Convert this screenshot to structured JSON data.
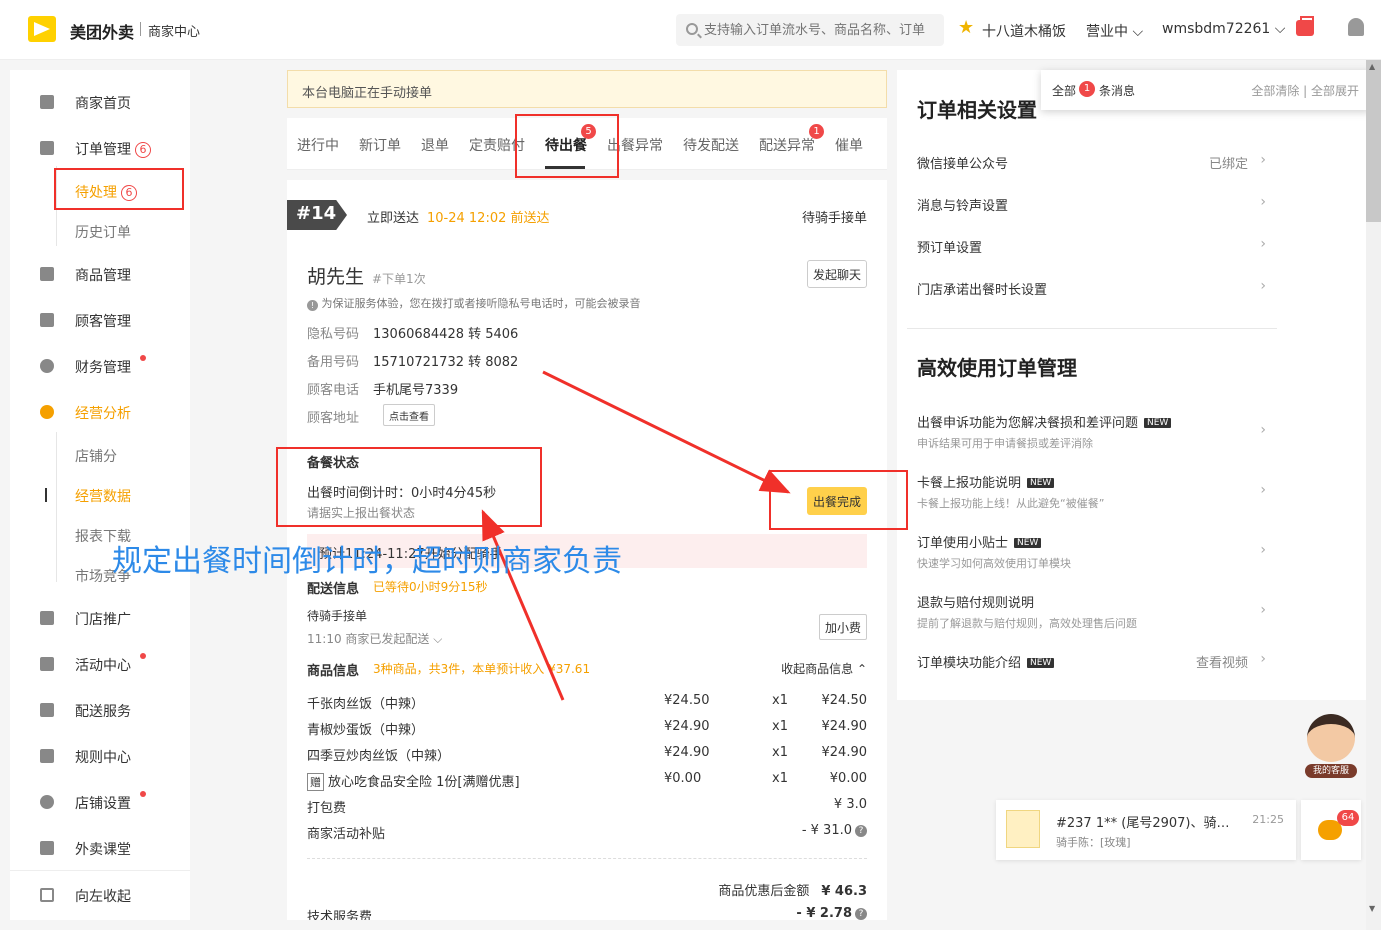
{
  "header": {
    "brand": "美团外卖",
    "brand_sub": "商家中心",
    "search_placeholder": "支持输入订单流水号、商品名称、订单",
    "shop_name": "十八道木桶饭",
    "status": "营业中 ⌵",
    "account": "wmsbdm72261 ⌵"
  },
  "sidebar": {
    "items": [
      {
        "label": "商家首页"
      },
      {
        "label": "订单管理",
        "badge": "6"
      },
      {
        "label": "商品管理"
      },
      {
        "label": "顾客管理"
      },
      {
        "label": "财务管理"
      },
      {
        "label": "经营分析"
      },
      {
        "label": "门店推广"
      },
      {
        "label": "活动中心"
      },
      {
        "label": "配送服务"
      },
      {
        "label": "规则中心"
      },
      {
        "label": "店铺设置"
      },
      {
        "label": "外卖课堂"
      },
      {
        "label": "向左收起"
      }
    ],
    "order_sub": {
      "pending": "待处理",
      "pending_badge": "6",
      "history": "历史订单"
    },
    "analysis_sub": [
      "店铺分",
      "经营数据",
      "报表下载",
      "市场竞争"
    ]
  },
  "notice": "本台电脑正在手动接单",
  "tabs": {
    "items": [
      "进行中",
      "新订单",
      "退单",
      "定责赔付",
      "待出餐",
      "出餐异常",
      "待发配送",
      "配送异常",
      "催单"
    ],
    "active": "待出餐",
    "badge_pending_meal": "5",
    "badge_delivery_exception": "1"
  },
  "order": {
    "number": "#14",
    "delivery_type": "立即送达",
    "delivery_time": "10-24 12:02 前送达",
    "rider_status": "待骑手接单",
    "customer_name": "胡先生",
    "customer_times": "#下单1次",
    "chat_button": "发起聊天",
    "privacy_tip": "为保证服务体验，您在拨打或者接听隐私号电话时，可能会被录音",
    "privacy_number_label": "隐私号码",
    "privacy_number": "13060684428 转 5406",
    "backup_number_label": "备用号码",
    "backup_number": "15710721732 转 8082",
    "customer_phone_label": "顾客电话",
    "customer_phone": "手机尾号7339",
    "address_label": "顾客地址",
    "view_button": "点击查看",
    "prep_title": "备餐状态",
    "prep_countdown": "出餐时间倒计时：0小时4分45秒",
    "prep_hint": "请据实上报出餐状态",
    "done_button": "出餐完成",
    "pink_text": "预计11:24-11:27开始分配骑手",
    "delivery_title": "配送信息",
    "delivery_wait": "已等待0小时9分15秒",
    "delivery_status": "待骑手接单",
    "delivery_note": "11:10 商家已发起配送 ⌵",
    "add_fee_button": "加小费",
    "goods_title": "商品信息",
    "goods_summary": "3种商品，共3件，本单预计收入 ¥37.61",
    "collapse_link": "收起商品信息 ⌃",
    "goods": [
      {
        "name": "千张肉丝饭（中辣）",
        "price": "¥24.50",
        "qty": "x1",
        "total": "¥24.50"
      },
      {
        "name": "青椒炒蛋饭（中辣）",
        "price": "¥24.90",
        "qty": "x1",
        "total": "¥24.90"
      },
      {
        "name": "四季豆炒肉丝饭（中辣）",
        "price": "¥24.90",
        "qty": "x1",
        "total": "¥24.90"
      },
      {
        "name": "放心吃食品安全险 1份[满赠优惠]",
        "price": "¥0.00",
        "qty": "x1",
        "total": "¥0.00",
        "gift": "赠"
      }
    ],
    "packing_fee_label": "打包费",
    "packing_fee": "¥ 3.0",
    "subsidy_label": "商家活动补贴",
    "subsidy": "- ¥ 31.0",
    "discounted_label": "商品优惠后金额",
    "discounted": "¥ 46.3",
    "service_fee_label": "技术服务费",
    "service_fee": "- ¥ 2.78"
  },
  "right_panel": {
    "settings_title": "订单相关设置",
    "settings": [
      {
        "label": "微信接单公众号",
        "value": "已绑定"
      },
      {
        "label": "消息与铃声设置"
      },
      {
        "label": "预订单设置"
      },
      {
        "label": "门店承诺出餐时长设置"
      }
    ],
    "tips_title": "高效使用订单管理",
    "tips": [
      {
        "title": "出餐申诉功能为您解决餐损和差评问题",
        "sub": "申诉结果可用于申请餐损或差评消除",
        "new": "NEW"
      },
      {
        "title": "卡餐上报功能说明",
        "sub": "卡餐上报功能上线！从此避免“被催餐”",
        "new": "NEW"
      },
      {
        "title": "订单使用小贴士",
        "sub": "快速学习如何高效使用订单模块",
        "new": "NEW"
      },
      {
        "title": "退款与赔付规则说明",
        "sub": "提前了解退款与赔付规则，高效处理售后问题"
      },
      {
        "title": "订单模块功能介绍",
        "new": "NEW",
        "value": "查看视频"
      }
    ]
  },
  "messages": {
    "all": "全部",
    "count": "1",
    "text": "条消息",
    "actions": "全部清除 | 全部展开"
  },
  "service_label": "我的客服",
  "notification": {
    "title": "#237  1** (尾号2907)、骑手…",
    "time": "21:25",
    "sub": "骑手陈：[玫瑰]",
    "chat_badge": "64"
  },
  "annotation": "规定出餐时间倒计时，超时则商家负责",
  "colors": {
    "accent": "#f5a000",
    "alert": "#f04848",
    "button_yellow": "#ffd04b",
    "annotation_blue": "#2d8ae8",
    "annotation_red": "#f0302a"
  }
}
